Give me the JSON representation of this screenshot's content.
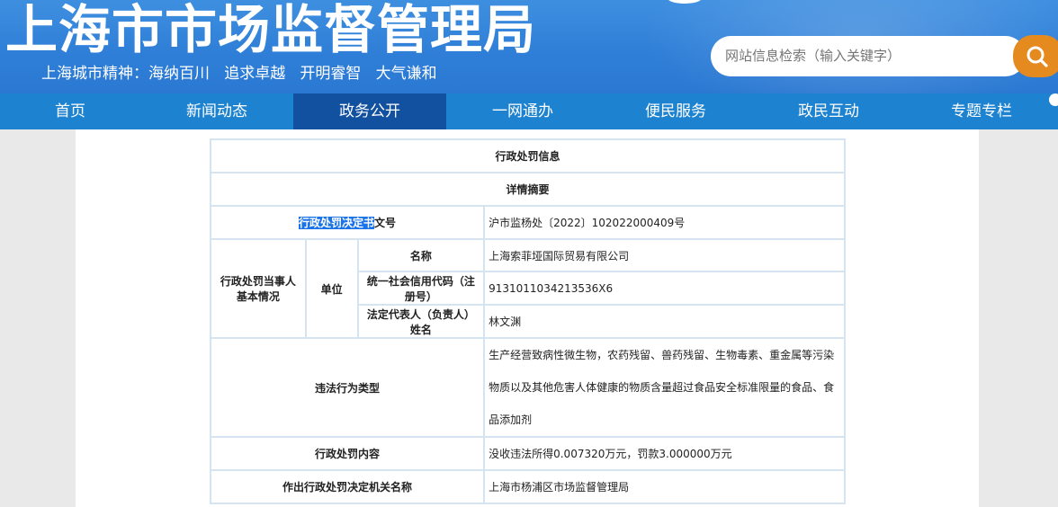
{
  "header": {
    "site_title": "上海市市场监督管理局",
    "slogan": "上海城市精神：海纳百川   追求卓越   开明睿智   大气谦和",
    "search_placeholder": "网站信息检索（输入关键字）"
  },
  "nav": {
    "items": [
      {
        "label": "首页"
      },
      {
        "label": "新闻动态"
      },
      {
        "label": "政务公开"
      },
      {
        "label": "一网通办"
      },
      {
        "label": "便民服务"
      },
      {
        "label": "政民互动"
      },
      {
        "label": "专题专栏"
      }
    ],
    "active": "政务公开"
  },
  "table": {
    "title": "行政处罚信息",
    "subtitle": "详情摘要",
    "decision_label_highlight": "行政处罚决定书",
    "decision_label_rest": "文号",
    "decision_number": "沪市监杨处〔2022〕102022000409号",
    "party_label": "行政处罚当事人基本情况",
    "unit_label": "单位",
    "name_label": "名称",
    "name_value": "上海索菲垭国际贸易有限公司",
    "credit_code_label": "统一社会信用代码（注册号）",
    "credit_code_value": "91310110342135​36X6",
    "legal_rep_label": "法定代表人（负责人）姓名",
    "legal_rep_value": "林文渊",
    "violation_type_label": "违法行为类型",
    "violation_type_value": "生产经营致病性微生物，农药残留、兽药残留、生物毒素、重金属等污染物质以及其他危害人体健康的物质含量超过食品安全标准限量的食品、食品添加剂",
    "penalty_content_label": "行政处罚内容",
    "penalty_content_value": "没收违法所得0.007320万元，罚款3.000000万元",
    "authority_label": "作出行政处罚决定机关名称",
    "authority_value": "上海市杨浦区市场监督管理局"
  }
}
